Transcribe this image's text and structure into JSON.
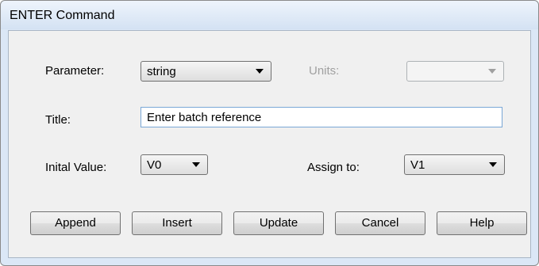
{
  "window": {
    "title": "ENTER Command"
  },
  "form": {
    "parameter_label": "Parameter:",
    "parameter_value": "string",
    "units_label": "Units:",
    "units_value": "",
    "title_label": "Title:",
    "title_value": "Enter batch reference",
    "initial_value_label": "Inital Value:",
    "initial_value": "V0",
    "assign_to_label": "Assign to:",
    "assign_to_value": "V1"
  },
  "buttons": {
    "append": "Append",
    "insert": "Insert",
    "update": "Update",
    "cancel": "Cancel",
    "help": "Help"
  }
}
